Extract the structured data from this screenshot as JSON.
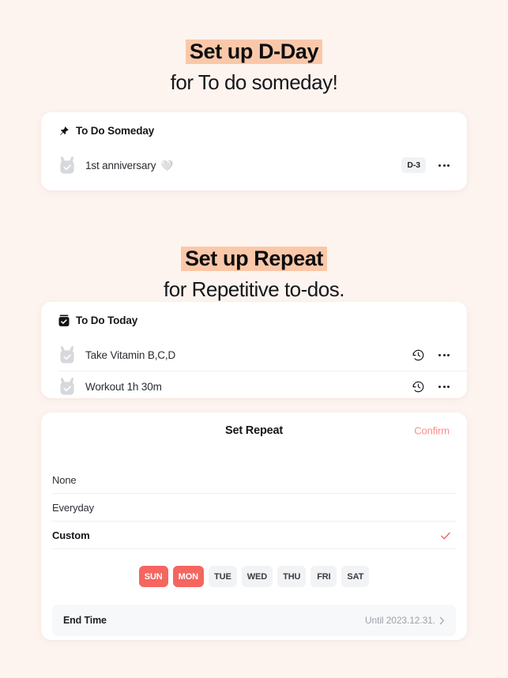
{
  "theme": {
    "page_bg": "#fdf4ef",
    "highlight": "#fac8a9",
    "accent_red": "#f4665f",
    "confirm_pink": "#fb8d86",
    "card_bg": "#ffffff"
  },
  "sections": [
    {
      "heading_line1": "Set up D-Day",
      "heading_line2": "for To do someday!"
    },
    {
      "heading_line1": "Set up Repeat",
      "heading_line2": "for Repetitive to-dos."
    }
  ],
  "someday_card": {
    "icon": "pushpin-icon",
    "title": "To Do Someday",
    "items": [
      {
        "checkbox_icon": "bunny-checkbox-icon",
        "label": "1st anniversary",
        "emoji": "🤍",
        "badge": "D-3",
        "more_icon": "more-dots-icon"
      }
    ]
  },
  "today_card": {
    "icon": "checkbox-checked-icon",
    "title": "To Do Today",
    "items": [
      {
        "checkbox_icon": "bunny-checkbox-icon",
        "label": "Take Vitamin B,C,D",
        "repeat_icon": "history-clock-icon",
        "more_icon": "more-dots-icon"
      },
      {
        "checkbox_icon": "bunny-checkbox-icon",
        "label": "Workout 1h 30m",
        "repeat_icon": "history-clock-icon",
        "more_icon": "more-dots-icon"
      }
    ]
  },
  "repeat_panel": {
    "title": "Set Repeat",
    "confirm_label": "Confirm",
    "options": [
      {
        "label": "None",
        "selected": false
      },
      {
        "label": "Everyday",
        "selected": false
      },
      {
        "label": "Custom",
        "selected": true,
        "check_icon": "check-icon"
      }
    ],
    "weekdays": [
      {
        "label": "SUN",
        "active": true
      },
      {
        "label": "MON",
        "active": true
      },
      {
        "label": "TUE",
        "active": false
      },
      {
        "label": "WED",
        "active": false
      },
      {
        "label": "THU",
        "active": false
      },
      {
        "label": "FRI",
        "active": false
      },
      {
        "label": "SAT",
        "active": false
      }
    ],
    "end_time": {
      "label": "End Time",
      "value": "Until 2023.12.31.",
      "chevron_icon": "chevron-right-icon"
    }
  }
}
